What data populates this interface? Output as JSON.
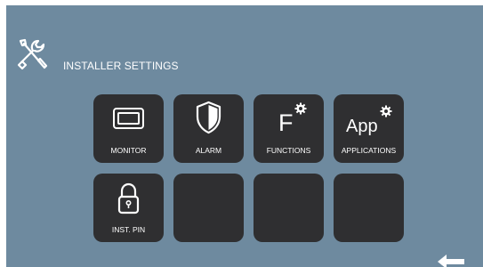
{
  "header": {
    "title": "INSTALLER SETTINGS",
    "icon": "tools-icon"
  },
  "tiles": [
    {
      "label": "MONITOR",
      "icon": "monitor-icon"
    },
    {
      "label": "ALARM",
      "icon": "shield-icon"
    },
    {
      "label": "FUNCTIONS",
      "icon": "functions-gear-icon",
      "glyph": "F"
    },
    {
      "label": "APPLICATIONS",
      "icon": "app-gear-icon",
      "glyph": "App"
    },
    {
      "label": "INST. PIN",
      "icon": "padlock-icon"
    },
    {
      "label": "",
      "icon": ""
    },
    {
      "label": "",
      "icon": ""
    },
    {
      "label": "",
      "icon": ""
    }
  ],
  "footer": {
    "back_icon": "back-arrow-icon"
  },
  "colors": {
    "background": "#6e8a9f",
    "tile": "#2f2f31",
    "foreground": "#ffffff"
  }
}
